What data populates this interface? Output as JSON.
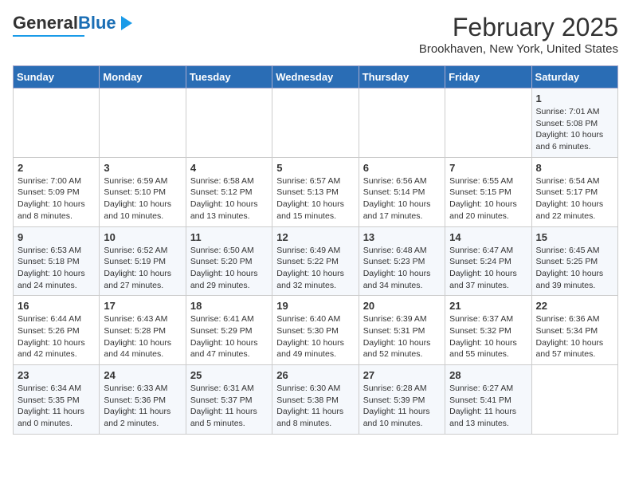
{
  "header": {
    "logo_general": "General",
    "logo_blue": "Blue",
    "month_title": "February 2025",
    "location": "Brookhaven, New York, United States"
  },
  "days_of_week": [
    "Sunday",
    "Monday",
    "Tuesday",
    "Wednesday",
    "Thursday",
    "Friday",
    "Saturday"
  ],
  "weeks": [
    [
      {
        "day": "",
        "sunrise": "",
        "sunset": "",
        "daylight": ""
      },
      {
        "day": "",
        "sunrise": "",
        "sunset": "",
        "daylight": ""
      },
      {
        "day": "",
        "sunrise": "",
        "sunset": "",
        "daylight": ""
      },
      {
        "day": "",
        "sunrise": "",
        "sunset": "",
        "daylight": ""
      },
      {
        "day": "",
        "sunrise": "",
        "sunset": "",
        "daylight": ""
      },
      {
        "day": "",
        "sunrise": "",
        "sunset": "",
        "daylight": ""
      },
      {
        "day": "1",
        "sunrise": "Sunrise: 7:01 AM",
        "sunset": "Sunset: 5:08 PM",
        "daylight": "Daylight: 10 hours and 6 minutes."
      }
    ],
    [
      {
        "day": "2",
        "sunrise": "Sunrise: 7:00 AM",
        "sunset": "Sunset: 5:09 PM",
        "daylight": "Daylight: 10 hours and 8 minutes."
      },
      {
        "day": "3",
        "sunrise": "Sunrise: 6:59 AM",
        "sunset": "Sunset: 5:10 PM",
        "daylight": "Daylight: 10 hours and 10 minutes."
      },
      {
        "day": "4",
        "sunrise": "Sunrise: 6:58 AM",
        "sunset": "Sunset: 5:12 PM",
        "daylight": "Daylight: 10 hours and 13 minutes."
      },
      {
        "day": "5",
        "sunrise": "Sunrise: 6:57 AM",
        "sunset": "Sunset: 5:13 PM",
        "daylight": "Daylight: 10 hours and 15 minutes."
      },
      {
        "day": "6",
        "sunrise": "Sunrise: 6:56 AM",
        "sunset": "Sunset: 5:14 PM",
        "daylight": "Daylight: 10 hours and 17 minutes."
      },
      {
        "day": "7",
        "sunrise": "Sunrise: 6:55 AM",
        "sunset": "Sunset: 5:15 PM",
        "daylight": "Daylight: 10 hours and 20 minutes."
      },
      {
        "day": "8",
        "sunrise": "Sunrise: 6:54 AM",
        "sunset": "Sunset: 5:17 PM",
        "daylight": "Daylight: 10 hours and 22 minutes."
      }
    ],
    [
      {
        "day": "9",
        "sunrise": "Sunrise: 6:53 AM",
        "sunset": "Sunset: 5:18 PM",
        "daylight": "Daylight: 10 hours and 24 minutes."
      },
      {
        "day": "10",
        "sunrise": "Sunrise: 6:52 AM",
        "sunset": "Sunset: 5:19 PM",
        "daylight": "Daylight: 10 hours and 27 minutes."
      },
      {
        "day": "11",
        "sunrise": "Sunrise: 6:50 AM",
        "sunset": "Sunset: 5:20 PM",
        "daylight": "Daylight: 10 hours and 29 minutes."
      },
      {
        "day": "12",
        "sunrise": "Sunrise: 6:49 AM",
        "sunset": "Sunset: 5:22 PM",
        "daylight": "Daylight: 10 hours and 32 minutes."
      },
      {
        "day": "13",
        "sunrise": "Sunrise: 6:48 AM",
        "sunset": "Sunset: 5:23 PM",
        "daylight": "Daylight: 10 hours and 34 minutes."
      },
      {
        "day": "14",
        "sunrise": "Sunrise: 6:47 AM",
        "sunset": "Sunset: 5:24 PM",
        "daylight": "Daylight: 10 hours and 37 minutes."
      },
      {
        "day": "15",
        "sunrise": "Sunrise: 6:45 AM",
        "sunset": "Sunset: 5:25 PM",
        "daylight": "Daylight: 10 hours and 39 minutes."
      }
    ],
    [
      {
        "day": "16",
        "sunrise": "Sunrise: 6:44 AM",
        "sunset": "Sunset: 5:26 PM",
        "daylight": "Daylight: 10 hours and 42 minutes."
      },
      {
        "day": "17",
        "sunrise": "Sunrise: 6:43 AM",
        "sunset": "Sunset: 5:28 PM",
        "daylight": "Daylight: 10 hours and 44 minutes."
      },
      {
        "day": "18",
        "sunrise": "Sunrise: 6:41 AM",
        "sunset": "Sunset: 5:29 PM",
        "daylight": "Daylight: 10 hours and 47 minutes."
      },
      {
        "day": "19",
        "sunrise": "Sunrise: 6:40 AM",
        "sunset": "Sunset: 5:30 PM",
        "daylight": "Daylight: 10 hours and 49 minutes."
      },
      {
        "day": "20",
        "sunrise": "Sunrise: 6:39 AM",
        "sunset": "Sunset: 5:31 PM",
        "daylight": "Daylight: 10 hours and 52 minutes."
      },
      {
        "day": "21",
        "sunrise": "Sunrise: 6:37 AM",
        "sunset": "Sunset: 5:32 PM",
        "daylight": "Daylight: 10 hours and 55 minutes."
      },
      {
        "day": "22",
        "sunrise": "Sunrise: 6:36 AM",
        "sunset": "Sunset: 5:34 PM",
        "daylight": "Daylight: 10 hours and 57 minutes."
      }
    ],
    [
      {
        "day": "23",
        "sunrise": "Sunrise: 6:34 AM",
        "sunset": "Sunset: 5:35 PM",
        "daylight": "Daylight: 11 hours and 0 minutes."
      },
      {
        "day": "24",
        "sunrise": "Sunrise: 6:33 AM",
        "sunset": "Sunset: 5:36 PM",
        "daylight": "Daylight: 11 hours and 2 minutes."
      },
      {
        "day": "25",
        "sunrise": "Sunrise: 6:31 AM",
        "sunset": "Sunset: 5:37 PM",
        "daylight": "Daylight: 11 hours and 5 minutes."
      },
      {
        "day": "26",
        "sunrise": "Sunrise: 6:30 AM",
        "sunset": "Sunset: 5:38 PM",
        "daylight": "Daylight: 11 hours and 8 minutes."
      },
      {
        "day": "27",
        "sunrise": "Sunrise: 6:28 AM",
        "sunset": "Sunset: 5:39 PM",
        "daylight": "Daylight: 11 hours and 10 minutes."
      },
      {
        "day": "28",
        "sunrise": "Sunrise: 6:27 AM",
        "sunset": "Sunset: 5:41 PM",
        "daylight": "Daylight: 11 hours and 13 minutes."
      },
      {
        "day": "",
        "sunrise": "",
        "sunset": "",
        "daylight": ""
      }
    ]
  ]
}
